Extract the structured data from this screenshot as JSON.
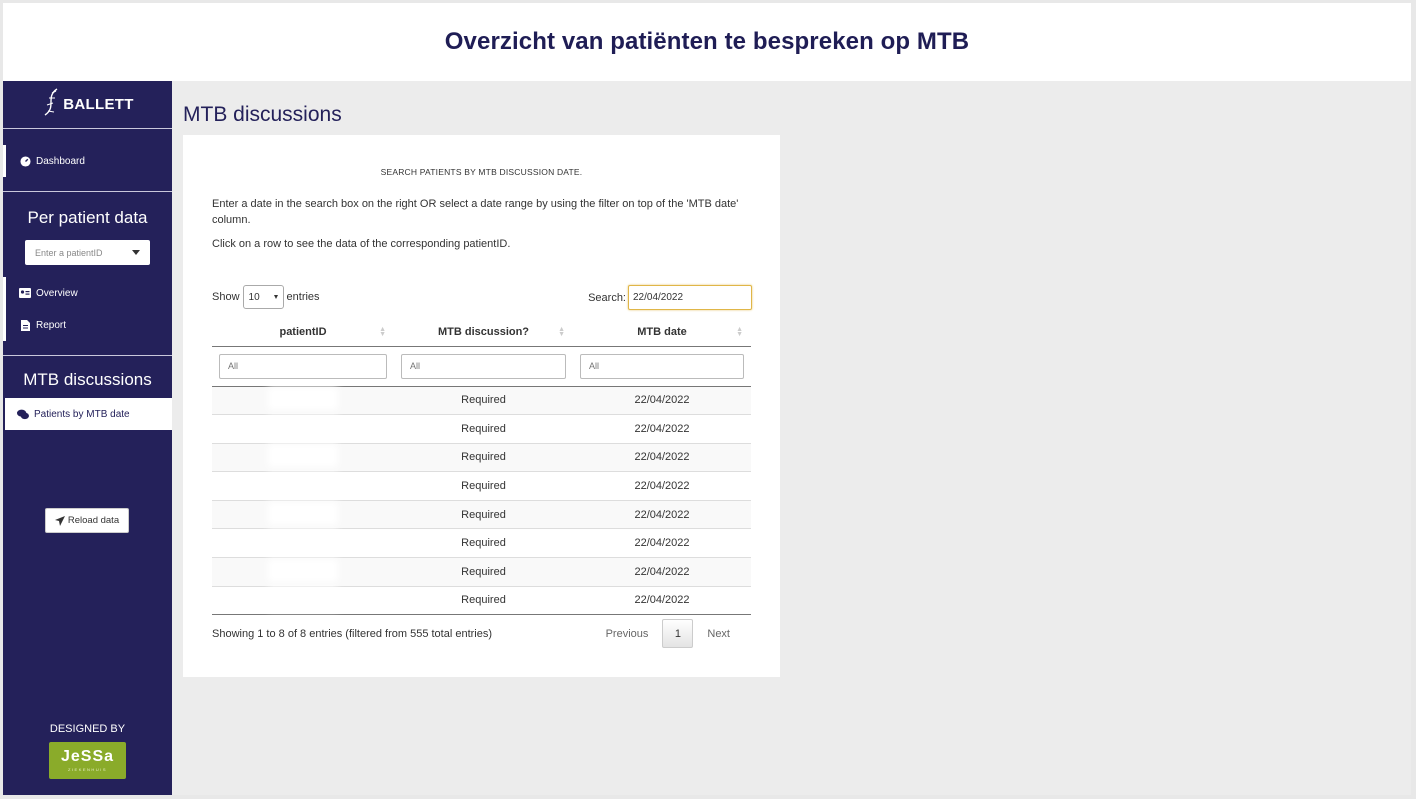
{
  "header": {
    "title": "Overzicht van patiënten te bespreken op MTB"
  },
  "sidebar": {
    "logo_text": "BALLETT",
    "dashboard_label": "Dashboard",
    "per_patient_title": "Per patient data",
    "patient_select_placeholder": "Enter a patientID",
    "overview_label": "Overview",
    "report_label": "Report",
    "mtb_title": "MTB discussions",
    "patients_by_date_label": "Patients by MTB date",
    "reload_label": "Reload data",
    "designed_by": "DESIGNED BY",
    "partner_logo_text": "JeSSa",
    "partner_logo_sub": "ZIEKENHUIS"
  },
  "main": {
    "heading": "MTB discussions",
    "box_heading": "SEARCH PATIENTS BY MTB DISCUSSION DATE.",
    "instruction_1": "Enter a date in the search box on the right OR select a date range by using the filter on top of the 'MTB date' column.",
    "instruction_2": "Click on a row to see the data of the corresponding patientID.",
    "show_label": "Show",
    "page_length": "10",
    "entries_label": "entries",
    "search_label": "Search:",
    "search_value": "22/04/2022",
    "columns": [
      "patientID",
      "MTB discussion?",
      "MTB date"
    ],
    "filter_placeholder": "All",
    "rows": [
      {
        "patientID": "",
        "discussion": "Required",
        "date": "22/04/2022"
      },
      {
        "patientID": "",
        "discussion": "Required",
        "date": "22/04/2022"
      },
      {
        "patientID": "",
        "discussion": "Required",
        "date": "22/04/2022"
      },
      {
        "patientID": "",
        "discussion": "Required",
        "date": "22/04/2022"
      },
      {
        "patientID": "",
        "discussion": "Required",
        "date": "22/04/2022"
      },
      {
        "patientID": "",
        "discussion": "Required",
        "date": "22/04/2022"
      },
      {
        "patientID": "",
        "discussion": "Required",
        "date": "22/04/2022"
      },
      {
        "patientID": "",
        "discussion": "Required",
        "date": "22/04/2022"
      }
    ],
    "info": "Showing 1 to 8 of 8 entries (filtered from 555 total entries)",
    "pager": {
      "previous": "Previous",
      "current": "1",
      "next": "Next"
    }
  }
}
